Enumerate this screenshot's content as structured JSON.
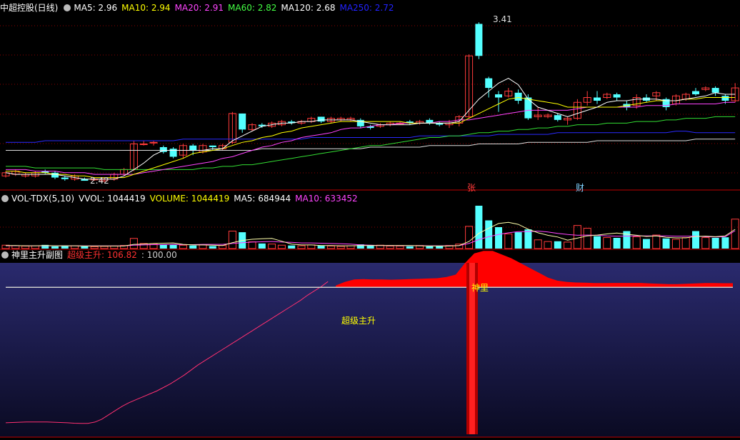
{
  "headers": {
    "main": {
      "items": [
        {
          "text": "中超控股(日线)",
          "color": "#ffffff"
        },
        {
          "text": "MA5: 2.96",
          "color": "#ffffff"
        },
        {
          "text": "MA10: 2.94",
          "color": "#ffff00"
        },
        {
          "text": "MA20: 2.91",
          "color": "#ff44ff"
        },
        {
          "text": "MA60: 2.82",
          "color": "#44ff44"
        },
        {
          "text": "MA120: 2.68",
          "color": "#ffffff"
        },
        {
          "text": "MA250: 2.72",
          "color": "#2222ff"
        }
      ]
    },
    "volume": {
      "items": [
        {
          "text": "VOL-TDX(5,10)",
          "color": "#ffffff"
        },
        {
          "text": "VVOL: 1044419",
          "color": "#ffffff"
        },
        {
          "text": "VOLUME: 1044419",
          "color": "#ffff00"
        },
        {
          "text": "MA5: 684944",
          "color": "#ffffff"
        },
        {
          "text": "MA10: 633452",
          "color": "#ff44ff"
        }
      ]
    },
    "indicator": {
      "items": [
        {
          "text": "神里主升副图",
          "color": "#ffffff"
        },
        {
          "text": "超级主升: 106.82",
          "color": "#ff3030"
        },
        {
          "text": ": 100.00",
          "color": "#cccccc"
        }
      ]
    }
  },
  "annotations": {
    "high": "3.41",
    "low": "2.42",
    "zhang": "张",
    "cai": "财",
    "shenli": "神里",
    "super": "超级主升"
  },
  "colors": {
    "up": "#ff3b3b",
    "down": "#54ffff",
    "grid": "#8b0000",
    "ma5": "#ffffff",
    "ma10": "#ffff00",
    "ma20": "#ff44ff",
    "ma60": "#33dd33",
    "ma120": "#dddddd",
    "ma250": "#2a2aff",
    "indicator_area": "#ff0000",
    "indicator_line": "#ff3070"
  },
  "chart_data": {
    "type": "candlestick",
    "price_ylim": [
      2.38,
      3.46
    ],
    "candles": [
      [
        2.45,
        2.47,
        2.44,
        2.48
      ],
      [
        2.46,
        2.48,
        2.45,
        2.49
      ],
      [
        2.45,
        2.46,
        2.44,
        2.47
      ],
      [
        2.45,
        2.47,
        2.44,
        2.48
      ],
      [
        2.48,
        2.47,
        2.46,
        2.49
      ],
      [
        2.47,
        2.44,
        2.43,
        2.48
      ],
      [
        2.44,
        2.43,
        2.42,
        2.45
      ],
      [
        2.43,
        2.45,
        2.42,
        2.46
      ],
      [
        2.43,
        2.42,
        2.42,
        2.44
      ],
      [
        2.43,
        2.43,
        2.42,
        2.44
      ],
      [
        2.42,
        2.43,
        2.41,
        2.44
      ],
      [
        2.43,
        2.46,
        2.42,
        2.47
      ],
      [
        2.46,
        2.49,
        2.45,
        2.5
      ],
      [
        2.49,
        2.65,
        2.48,
        2.67
      ],
      [
        2.65,
        2.65,
        2.64,
        2.67
      ],
      [
        2.66,
        2.66,
        2.64,
        2.67
      ],
      [
        2.63,
        2.6,
        2.59,
        2.64
      ],
      [
        2.62,
        2.57,
        2.56,
        2.63
      ],
      [
        2.58,
        2.64,
        2.56,
        2.65
      ],
      [
        2.64,
        2.61,
        2.58,
        2.65
      ],
      [
        2.6,
        2.64,
        2.59,
        2.65
      ],
      [
        2.64,
        2.63,
        2.61,
        2.64
      ],
      [
        2.62,
        2.64,
        2.61,
        2.65
      ],
      [
        2.66,
        2.84,
        2.65,
        2.85
      ],
      [
        2.84,
        2.74,
        2.72,
        2.84
      ],
      [
        2.74,
        2.77,
        2.73,
        2.78
      ],
      [
        2.77,
        2.76,
        2.75,
        2.78
      ],
      [
        2.76,
        2.78,
        2.75,
        2.79
      ],
      [
        2.77,
        2.79,
        2.76,
        2.8
      ],
      [
        2.79,
        2.78,
        2.77,
        2.8
      ],
      [
        2.78,
        2.79,
        2.77,
        2.8
      ],
      [
        2.79,
        2.81,
        2.78,
        2.82
      ],
      [
        2.82,
        2.79,
        2.78,
        2.82
      ],
      [
        2.79,
        2.81,
        2.78,
        2.82
      ],
      [
        2.8,
        2.81,
        2.79,
        2.82
      ],
      [
        2.8,
        2.81,
        2.79,
        2.82
      ],
      [
        2.8,
        2.76,
        2.75,
        2.81
      ],
      [
        2.76,
        2.75,
        2.74,
        2.77
      ],
      [
        2.76,
        2.77,
        2.75,
        2.78
      ],
      [
        2.77,
        2.78,
        2.76,
        2.79
      ],
      [
        2.78,
        2.78,
        2.77,
        2.79
      ],
      [
        2.79,
        2.78,
        2.77,
        2.8
      ],
      [
        2.78,
        2.79,
        2.77,
        2.8
      ],
      [
        2.8,
        2.78,
        2.77,
        2.81
      ],
      [
        2.78,
        2.77,
        2.76,
        2.79
      ],
      [
        2.77,
        2.78,
        2.75,
        2.8
      ],
      [
        2.78,
        2.82,
        2.76,
        2.83
      ],
      [
        2.82,
        3.2,
        2.81,
        3.21
      ],
      [
        3.4,
        3.2,
        3.18,
        3.41
      ],
      [
        3.06,
        3.0,
        2.94,
        3.07
      ],
      [
        2.96,
        2.94,
        2.85,
        2.98
      ],
      [
        2.95,
        2.98,
        2.94,
        3.0
      ],
      [
        2.97,
        2.92,
        2.9,
        2.99
      ],
      [
        2.94,
        2.81,
        2.8,
        2.96
      ],
      [
        2.82,
        2.83,
        2.8,
        2.88
      ],
      [
        2.82,
        2.83,
        2.81,
        2.84
      ],
      [
        2.83,
        2.8,
        2.79,
        2.84
      ],
      [
        2.8,
        2.81,
        2.77,
        2.82
      ],
      [
        2.81,
        2.91,
        2.8,
        2.93
      ],
      [
        2.91,
        2.94,
        2.89,
        2.98
      ],
      [
        2.94,
        2.92,
        2.9,
        2.98
      ],
      [
        2.94,
        2.96,
        2.93,
        2.97
      ],
      [
        2.96,
        2.94,
        2.92,
        2.97
      ],
      [
        2.9,
        2.88,
        2.86,
        2.92
      ],
      [
        2.89,
        2.94,
        2.87,
        2.96
      ],
      [
        2.94,
        2.92,
        2.91,
        2.96
      ],
      [
        2.95,
        2.97,
        2.92,
        2.98
      ],
      [
        2.93,
        2.88,
        2.86,
        2.94
      ],
      [
        2.9,
        2.95,
        2.89,
        2.96
      ],
      [
        2.93,
        2.96,
        2.92,
        2.97
      ],
      [
        2.98,
        2.96,
        2.95,
        3.0
      ],
      [
        2.99,
        3.0,
        2.98,
        3.01
      ],
      [
        3.0,
        2.97,
        2.95,
        3.01
      ],
      [
        2.95,
        2.92,
        2.9,
        2.96
      ],
      [
        2.92,
        3.0,
        2.91,
        3.03
      ]
    ],
    "ma5": [
      2.47,
      2.46,
      2.46,
      2.46,
      2.46,
      2.46,
      2.45,
      2.44,
      2.43,
      2.43,
      2.43,
      2.43,
      2.45,
      2.49,
      2.53,
      2.58,
      2.61,
      2.61,
      2.61,
      2.61,
      2.61,
      2.62,
      2.62,
      2.67,
      2.7,
      2.73,
      2.76,
      2.77,
      2.78,
      2.78,
      2.79,
      2.79,
      2.8,
      2.8,
      2.8,
      2.8,
      2.79,
      2.78,
      2.77,
      2.77,
      2.77,
      2.77,
      2.78,
      2.78,
      2.78,
      2.78,
      2.79,
      2.86,
      2.93,
      2.98,
      3.03,
      3.06,
      3.02,
      2.93,
      2.88,
      2.86,
      2.84,
      2.82,
      2.84,
      2.86,
      2.88,
      2.91,
      2.92,
      2.92,
      2.93,
      2.93,
      2.93,
      2.92,
      2.92,
      2.93,
      2.94,
      2.95,
      2.97,
      2.96,
      2.96
    ],
    "ma10": [
      2.48,
      2.48,
      2.47,
      2.47,
      2.47,
      2.46,
      2.46,
      2.45,
      2.45,
      2.44,
      2.44,
      2.44,
      2.44,
      2.46,
      2.48,
      2.5,
      2.52,
      2.54,
      2.56,
      2.59,
      2.6,
      2.61,
      2.62,
      2.64,
      2.66,
      2.67,
      2.69,
      2.7,
      2.72,
      2.73,
      2.75,
      2.76,
      2.77,
      2.78,
      2.79,
      2.79,
      2.79,
      2.79,
      2.79,
      2.79,
      2.79,
      2.78,
      2.78,
      2.78,
      2.78,
      2.78,
      2.78,
      2.81,
      2.84,
      2.87,
      2.9,
      2.93,
      2.94,
      2.93,
      2.92,
      2.91,
      2.9,
      2.88,
      2.88,
      2.88,
      2.88,
      2.88,
      2.88,
      2.89,
      2.9,
      2.91,
      2.92,
      2.92,
      2.92,
      2.93,
      2.93,
      2.94,
      2.94,
      2.94,
      2.94
    ],
    "ma20": [
      2.49,
      2.49,
      2.49,
      2.48,
      2.48,
      2.48,
      2.47,
      2.47,
      2.47,
      2.46,
      2.46,
      2.46,
      2.46,
      2.46,
      2.47,
      2.48,
      2.49,
      2.5,
      2.51,
      2.52,
      2.53,
      2.54,
      2.56,
      2.57,
      2.59,
      2.61,
      2.63,
      2.64,
      2.66,
      2.67,
      2.69,
      2.7,
      2.71,
      2.72,
      2.74,
      2.75,
      2.75,
      2.76,
      2.77,
      2.77,
      2.78,
      2.78,
      2.78,
      2.78,
      2.79,
      2.79,
      2.8,
      2.8,
      2.81,
      2.82,
      2.83,
      2.84,
      2.85,
      2.86,
      2.86,
      2.86,
      2.86,
      2.86,
      2.87,
      2.88,
      2.88,
      2.88,
      2.88,
      2.88,
      2.88,
      2.89,
      2.89,
      2.89,
      2.9,
      2.9,
      2.9,
      2.9,
      2.9,
      2.91,
      2.91
    ],
    "ma60": [
      2.51,
      2.51,
      2.51,
      2.5,
      2.5,
      2.5,
      2.5,
      2.5,
      2.5,
      2.5,
      2.49,
      2.49,
      2.49,
      2.49,
      2.49,
      2.49,
      2.49,
      2.49,
      2.49,
      2.49,
      2.5,
      2.5,
      2.51,
      2.51,
      2.52,
      2.52,
      2.53,
      2.54,
      2.55,
      2.56,
      2.57,
      2.58,
      2.59,
      2.6,
      2.61,
      2.62,
      2.63,
      2.64,
      2.64,
      2.65,
      2.66,
      2.67,
      2.68,
      2.69,
      2.69,
      2.7,
      2.7,
      2.71,
      2.72,
      2.72,
      2.73,
      2.73,
      2.74,
      2.74,
      2.75,
      2.75,
      2.76,
      2.76,
      2.77,
      2.77,
      2.77,
      2.78,
      2.78,
      2.78,
      2.79,
      2.79,
      2.79,
      2.8,
      2.8,
      2.81,
      2.81,
      2.81,
      2.82,
      2.82,
      2.82
    ],
    "ma120": [
      2.61,
      2.61,
      2.61,
      2.61,
      2.61,
      2.61,
      2.61,
      2.61,
      2.61,
      2.61,
      2.61,
      2.61,
      2.61,
      2.61,
      2.61,
      2.61,
      2.61,
      2.61,
      2.61,
      2.61,
      2.61,
      2.61,
      2.61,
      2.61,
      2.61,
      2.61,
      2.62,
      2.62,
      2.62,
      2.62,
      2.62,
      2.62,
      2.62,
      2.62,
      2.62,
      2.62,
      2.62,
      2.63,
      2.63,
      2.63,
      2.63,
      2.63,
      2.63,
      2.64,
      2.64,
      2.64,
      2.64,
      2.64,
      2.65,
      2.65,
      2.65,
      2.65,
      2.65,
      2.66,
      2.66,
      2.66,
      2.66,
      2.66,
      2.66,
      2.66,
      2.67,
      2.67,
      2.67,
      2.67,
      2.67,
      2.67,
      2.67,
      2.67,
      2.67,
      2.67,
      2.68,
      2.68,
      2.68,
      2.68,
      2.68
    ],
    "ma250": [
      2.66,
      2.66,
      2.66,
      2.66,
      2.67,
      2.67,
      2.67,
      2.67,
      2.67,
      2.67,
      2.67,
      2.67,
      2.67,
      2.67,
      2.67,
      2.67,
      2.67,
      2.67,
      2.68,
      2.68,
      2.68,
      2.68,
      2.68,
      2.68,
      2.68,
      2.68,
      2.68,
      2.68,
      2.68,
      2.68,
      2.68,
      2.69,
      2.69,
      2.69,
      2.69,
      2.69,
      2.69,
      2.69,
      2.69,
      2.69,
      2.69,
      2.69,
      2.7,
      2.7,
      2.7,
      2.7,
      2.7,
      2.7,
      2.7,
      2.7,
      2.71,
      2.71,
      2.71,
      2.71,
      2.71,
      2.71,
      2.72,
      2.72,
      2.72,
      2.72,
      2.72,
      2.72,
      2.72,
      2.72,
      2.72,
      2.72,
      2.72,
      2.72,
      2.73,
      2.73,
      2.72,
      2.72,
      2.72,
      2.72,
      2.72
    ],
    "volume_ylim": [
      0,
      1520000
    ],
    "volume": [
      120000,
      100000,
      90000,
      100000,
      130000,
      80000,
      90000,
      100000,
      80000,
      70000,
      80000,
      90000,
      110000,
      360000,
      180000,
      170000,
      140000,
      130000,
      120000,
      110000,
      130000,
      90000,
      110000,
      620000,
      580000,
      240000,
      180000,
      160000,
      120000,
      110000,
      100000,
      130000,
      100000,
      90000,
      80000,
      100000,
      150000,
      110000,
      120000,
      90000,
      90000,
      80000,
      110000,
      80000,
      90000,
      110000,
      160000,
      790000,
      1520000,
      1000000,
      760000,
      520000,
      580000,
      680000,
      310000,
      250000,
      260000,
      230000,
      820000,
      720000,
      440000,
      390000,
      380000,
      620000,
      420000,
      340000,
      480000,
      360000,
      330000,
      390000,
      620000,
      390000,
      380000,
      400000,
      1044419
    ],
    "vol_ma5": [
      110000,
      110000,
      100000,
      100000,
      110000,
      100000,
      100000,
      100000,
      90000,
      90000,
      90000,
      90000,
      90000,
      150000,
      160000,
      180000,
      190000,
      200000,
      150000,
      130000,
      130000,
      120000,
      110000,
      210000,
      290000,
      330000,
      350000,
      360000,
      260000,
      160000,
      130000,
      130000,
      110000,
      110000,
      100000,
      100000,
      110000,
      110000,
      110000,
      110000,
      110000,
      110000,
      100000,
      90000,
      90000,
      90000,
      110000,
      250000,
      540000,
      720000,
      890000,
      930000,
      860000,
      690000,
      560000,
      470000,
      410000,
      300000,
      370000,
      450000,
      480000,
      520000,
      550000,
      510000,
      470000,
      430000,
      450000,
      400000,
      380000,
      380000,
      430000,
      440000,
      420000,
      450000,
      684944
    ],
    "vol_ma10": [
      100000,
      105000,
      100000,
      100000,
      100000,
      100000,
      100000,
      100000,
      95000,
      95000,
      95000,
      95000,
      95000,
      120000,
      130000,
      140000,
      140000,
      150000,
      140000,
      140000,
      150000,
      150000,
      150000,
      180000,
      210000,
      230000,
      240000,
      250000,
      230000,
      220000,
      200000,
      200000,
      190000,
      180000,
      170000,
      160000,
      130000,
      120000,
      110000,
      110000,
      105000,
      105000,
      105000,
      100000,
      100000,
      100000,
      110000,
      180000,
      320000,
      420000,
      500000,
      560000,
      600000,
      600000,
      620000,
      590000,
      540000,
      500000,
      470000,
      480000,
      470000,
      450000,
      440000,
      440000,
      450000,
      450000,
      450000,
      450000,
      440000,
      440000,
      440000,
      420000,
      410000,
      420000,
      633452
    ],
    "indicator_ylim": [
      0,
      115
    ],
    "indicator_area": [
      0,
      0,
      0,
      0,
      0,
      0,
      0,
      0,
      0,
      0,
      0,
      0,
      0,
      0,
      0,
      0,
      0,
      0,
      0,
      0,
      0,
      0,
      0,
      0,
      0,
      0,
      0,
      0,
      0,
      0,
      0,
      0,
      0,
      0,
      0,
      0,
      0,
      0,
      0,
      0,
      0,
      0,
      0,
      0,
      0,
      0,
      0,
      0,
      0,
      0,
      0,
      0,
      0,
      0,
      0,
      0,
      0,
      0,
      0,
      0,
      0,
      0,
      0,
      0,
      0,
      0,
      0,
      0,
      0,
      0,
      0,
      0,
      0,
      0,
      0
    ],
    "indicator_levels": [
      6.0,
      6.2,
      6.4,
      6.6,
      6.6,
      6.6,
      6.6,
      6.4,
      6.2,
      6.0,
      5.7,
      5.6,
      5.6,
      6.5,
      8.5,
      11.5,
      14.5,
      17.5,
      20.0,
      22.0,
      24.0,
      26.0,
      28.0,
      30.5,
      33.0,
      36.0,
      39.0,
      42.5,
      46.0,
      49.0,
      52.0,
      55.0,
      58.0,
      61.0,
      64.0,
      67.0,
      70.0,
      73.0,
      76.0,
      79.0,
      82.0,
      85.0,
      88.0,
      91.0,
      94.5,
      97.5,
      100.5,
      104.0,
      106.8,
      107.8,
      107.3,
      107.0,
      106.6,
      106.5,
      106.4,
      106.3,
      106.3,
      106.3,
      106.5,
      106.9,
      107.4,
      108.0,
      108.6,
      109.2,
      109.7,
      110.0,
      110.0,
      110.0,
      110.0,
      110.0,
      110.0,
      110.0,
      110.0,
      110.0,
      110.0
    ],
    "indicator_red_area": [
      0,
      0,
      0,
      0,
      0,
      0,
      0,
      0,
      0,
      0,
      0,
      0,
      0,
      0,
      0,
      0,
      0,
      0,
      0,
      0,
      0,
      0,
      0,
      0,
      0,
      0,
      0,
      0,
      0,
      0,
      0,
      0,
      0,
      0,
      0,
      0,
      0,
      0,
      0,
      0,
      0,
      0,
      0,
      0,
      0,
      0,
      0,
      1.5,
      4.5,
      6.5,
      6.8,
      6.5,
      6.5,
      6.3,
      6.5,
      6.8,
      7.0,
      7.3,
      7.5,
      8.5,
      10.5,
      20,
      28,
      30,
      30,
      27,
      24,
      20,
      16,
      12,
      8,
      5.5,
      4.5,
      4.0,
      3.8,
      3.5,
      3.5,
      3.6,
      3.6,
      3.6,
      3.6,
      3.2,
      3.0,
      2.7,
      2.6,
      2.9,
      3.3,
      3.5,
      3.5,
      3.4,
      3.4
    ],
    "super_rise_level": 106.82,
    "base_level": 100.0
  }
}
